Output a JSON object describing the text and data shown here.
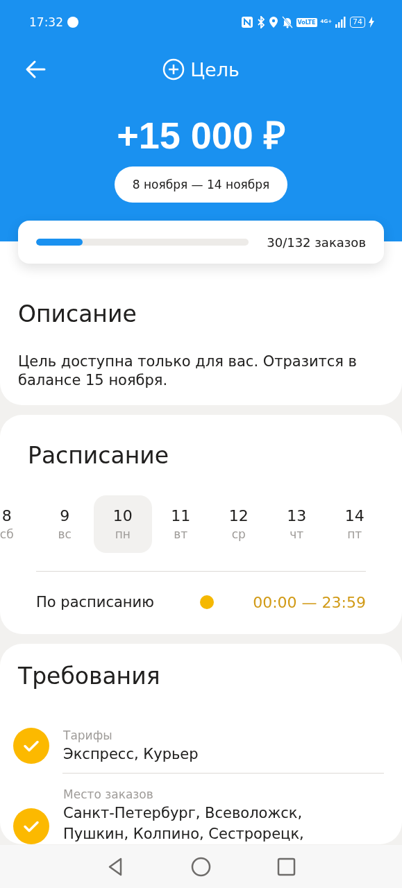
{
  "status_bar": {
    "time": "17:32",
    "volte": "VoLTE",
    "network": "4G+",
    "battery": "74"
  },
  "header": {
    "title": "Цель",
    "amount": "+15 000 ₽",
    "period": "8 ноября — 14 ноября"
  },
  "progress": {
    "level": 0.22,
    "reading": "30/132 заказов"
  },
  "description": {
    "title": "Описание",
    "text": "Цель доступна только для вас. Отразится в балансе 15 ноября."
  },
  "schedule": {
    "title": "Расписание",
    "days": [
      {
        "date": "8",
        "weekday": "сб",
        "selected": false
      },
      {
        "date": "9",
        "weekday": "вс",
        "selected": false
      },
      {
        "date": "10",
        "weekday": "пн",
        "selected": true
      },
      {
        "date": "11",
        "weekday": "вт",
        "selected": false
      },
      {
        "date": "12",
        "weekday": "ср",
        "selected": false
      },
      {
        "date": "13",
        "weekday": "чт",
        "selected": false
      },
      {
        "date": "14",
        "weekday": "пт",
        "selected": false
      }
    ],
    "mode": "По расписанию",
    "hours": "00:00 — 23:59"
  },
  "requirements": {
    "title": "Требования",
    "items": [
      {
        "label": "Тарифы",
        "value": "Экспресс, Курьер",
        "checked": true
      },
      {
        "label": "Место заказов",
        "value": "Санкт-Петербург, Всеволожск, Пушкин, Колпино, Сестрорецк,",
        "checked": true
      }
    ]
  }
}
